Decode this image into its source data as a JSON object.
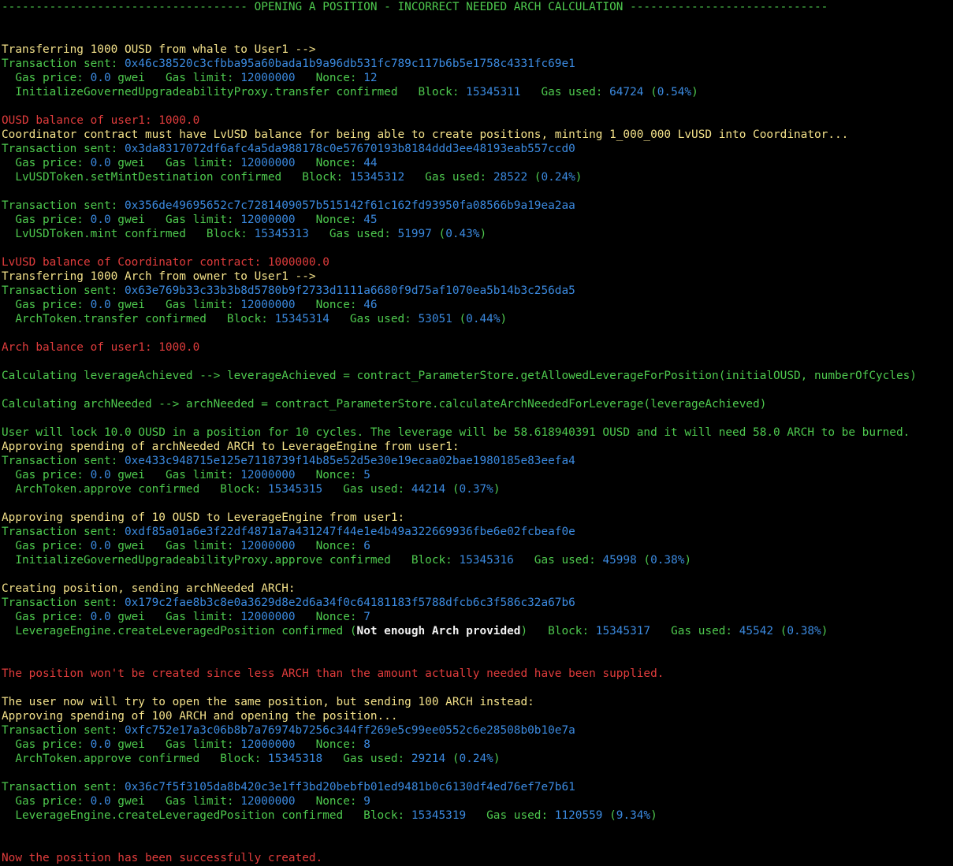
{
  "colors": {
    "background": "#000000",
    "green": "#4ec94e",
    "yellow": "#f3e18a",
    "blue": "#3b8ae0",
    "red": "#e03c3c",
    "bold_white": "#f2f2f2"
  },
  "lines": [
    [
      {
        "t": "------------------------------------ OPENING A POSITION - INCORRECT NEEDED ARCH CALCULATION -----------------------------",
        "c": "green"
      }
    ],
    [],
    [],
    [
      {
        "t": "Transferring 1000 OUSD from whale to User1 -->",
        "c": "yellow"
      }
    ],
    [
      {
        "t": "Transaction sent: ",
        "c": "green"
      },
      {
        "t": "0x46c38520c3cfbba95a60bada1b9a96db531fc789c117b6b5e1758c4331fc69e1",
        "c": "blue"
      }
    ],
    [
      {
        "t": "  Gas price: ",
        "c": "green"
      },
      {
        "t": "0.0",
        "c": "blue"
      },
      {
        "t": " gwei   Gas limit: ",
        "c": "green"
      },
      {
        "t": "12000000",
        "c": "blue"
      },
      {
        "t": "   Nonce: ",
        "c": "green"
      },
      {
        "t": "12",
        "c": "blue"
      }
    ],
    [
      {
        "t": "  InitializeGovernedUpgradeabilityProxy.transfer confirmed   Block: ",
        "c": "green"
      },
      {
        "t": "15345311",
        "c": "blue"
      },
      {
        "t": "   Gas used: ",
        "c": "green"
      },
      {
        "t": "64724",
        "c": "blue"
      },
      {
        "t": " (",
        "c": "green"
      },
      {
        "t": "0.54%",
        "c": "blue"
      },
      {
        "t": ")",
        "c": "green"
      }
    ],
    [],
    [
      {
        "t": "OUSD balance of user1: 1000.0",
        "c": "red"
      }
    ],
    [
      {
        "t": "Coordinator contract must have LvUSD balance for being able to create positions, minting 1_000_000 LvUSD into Coordinator...",
        "c": "yellow"
      }
    ],
    [
      {
        "t": "Transaction sent: ",
        "c": "green"
      },
      {
        "t": "0x3da8317072df6afc4a5da988178c0e57670193b8184ddd3ee48193eab557ccd0",
        "c": "blue"
      }
    ],
    [
      {
        "t": "  Gas price: ",
        "c": "green"
      },
      {
        "t": "0.0",
        "c": "blue"
      },
      {
        "t": " gwei   Gas limit: ",
        "c": "green"
      },
      {
        "t": "12000000",
        "c": "blue"
      },
      {
        "t": "   Nonce: ",
        "c": "green"
      },
      {
        "t": "44",
        "c": "blue"
      }
    ],
    [
      {
        "t": "  LvUSDToken.setMintDestination confirmed   Block: ",
        "c": "green"
      },
      {
        "t": "15345312",
        "c": "blue"
      },
      {
        "t": "   Gas used: ",
        "c": "green"
      },
      {
        "t": "28522",
        "c": "blue"
      },
      {
        "t": " (",
        "c": "green"
      },
      {
        "t": "0.24%",
        "c": "blue"
      },
      {
        "t": ")",
        "c": "green"
      }
    ],
    [],
    [
      {
        "t": "Transaction sent: ",
        "c": "green"
      },
      {
        "t": "0x356de49695652c7c7281409057b515142f61c162fd93950fa08566b9a19ea2aa",
        "c": "blue"
      }
    ],
    [
      {
        "t": "  Gas price: ",
        "c": "green"
      },
      {
        "t": "0.0",
        "c": "blue"
      },
      {
        "t": " gwei   Gas limit: ",
        "c": "green"
      },
      {
        "t": "12000000",
        "c": "blue"
      },
      {
        "t": "   Nonce: ",
        "c": "green"
      },
      {
        "t": "45",
        "c": "blue"
      }
    ],
    [
      {
        "t": "  LvUSDToken.mint confirmed   Block: ",
        "c": "green"
      },
      {
        "t": "15345313",
        "c": "blue"
      },
      {
        "t": "   Gas used: ",
        "c": "green"
      },
      {
        "t": "51997",
        "c": "blue"
      },
      {
        "t": " (",
        "c": "green"
      },
      {
        "t": "0.43%",
        "c": "blue"
      },
      {
        "t": ")",
        "c": "green"
      }
    ],
    [],
    [
      {
        "t": "LvUSD balance of Coordinator contract: 1000000.0",
        "c": "red"
      }
    ],
    [
      {
        "t": "Transferring 1000 Arch from owner to User1 -->",
        "c": "yellow"
      }
    ],
    [
      {
        "t": "Transaction sent: ",
        "c": "green"
      },
      {
        "t": "0x63e769b33c33b3b8d5780b9f2733d1111a6680f9d75af1070ea5b14b3c256da5",
        "c": "blue"
      }
    ],
    [
      {
        "t": "  Gas price: ",
        "c": "green"
      },
      {
        "t": "0.0",
        "c": "blue"
      },
      {
        "t": " gwei   Gas limit: ",
        "c": "green"
      },
      {
        "t": "12000000",
        "c": "blue"
      },
      {
        "t": "   Nonce: ",
        "c": "green"
      },
      {
        "t": "46",
        "c": "blue"
      }
    ],
    [
      {
        "t": "  ArchToken.transfer confirmed   Block: ",
        "c": "green"
      },
      {
        "t": "15345314",
        "c": "blue"
      },
      {
        "t": "   Gas used: ",
        "c": "green"
      },
      {
        "t": "53051",
        "c": "blue"
      },
      {
        "t": " (",
        "c": "green"
      },
      {
        "t": "0.44%",
        "c": "blue"
      },
      {
        "t": ")",
        "c": "green"
      }
    ],
    [],
    [
      {
        "t": "Arch balance of user1: 1000.0",
        "c": "red"
      }
    ],
    [],
    [
      {
        "t": "Calculating leverageAchieved --> leverageAchieved = contract_ParameterStore.getAllowedLeverageForPosition(initialOUSD, numberOfCycles)",
        "c": "green"
      }
    ],
    [],
    [
      {
        "t": "Calculating archNeeded --> archNeeded = contract_ParameterStore.calculateArchNeededForLeverage(leverageAchieved)",
        "c": "green"
      }
    ],
    [],
    [
      {
        "t": "User will lock 10.0 OUSD in a position for 10 cycles. The leverage will be 58.618940391 OUSD and it will need 58.0 ARCH to be burned.",
        "c": "green"
      }
    ],
    [
      {
        "t": "Approving spending of archNeeded ARCH to LeverageEngine from user1:",
        "c": "yellow"
      }
    ],
    [
      {
        "t": "Transaction sent: ",
        "c": "green"
      },
      {
        "t": "0xe433c948715e125e7118739f14b85e52d5e30e19ecaa02bae1980185e83eefa4",
        "c": "blue"
      }
    ],
    [
      {
        "t": "  Gas price: ",
        "c": "green"
      },
      {
        "t": "0.0",
        "c": "blue"
      },
      {
        "t": " gwei   Gas limit: ",
        "c": "green"
      },
      {
        "t": "12000000",
        "c": "blue"
      },
      {
        "t": "   Nonce: ",
        "c": "green"
      },
      {
        "t": "5",
        "c": "blue"
      }
    ],
    [
      {
        "t": "  ArchToken.approve confirmed   Block: ",
        "c": "green"
      },
      {
        "t": "15345315",
        "c": "blue"
      },
      {
        "t": "   Gas used: ",
        "c": "green"
      },
      {
        "t": "44214",
        "c": "blue"
      },
      {
        "t": " (",
        "c": "green"
      },
      {
        "t": "0.37%",
        "c": "blue"
      },
      {
        "t": ")",
        "c": "green"
      }
    ],
    [],
    [
      {
        "t": "Approving spending of 10 OUSD to LeverageEngine from user1:",
        "c": "yellow"
      }
    ],
    [
      {
        "t": "Transaction sent: ",
        "c": "green"
      },
      {
        "t": "0xdf85a01a6e3f22df4871a7a431247f44e1e4b49a322669936fbe6e02fcbeaf0e",
        "c": "blue"
      }
    ],
    [
      {
        "t": "  Gas price: ",
        "c": "green"
      },
      {
        "t": "0.0",
        "c": "blue"
      },
      {
        "t": " gwei   Gas limit: ",
        "c": "green"
      },
      {
        "t": "12000000",
        "c": "blue"
      },
      {
        "t": "   Nonce: ",
        "c": "green"
      },
      {
        "t": "6",
        "c": "blue"
      }
    ],
    [
      {
        "t": "  InitializeGovernedUpgradeabilityProxy.approve confirmed   Block: ",
        "c": "green"
      },
      {
        "t": "15345316",
        "c": "blue"
      },
      {
        "t": "   Gas used: ",
        "c": "green"
      },
      {
        "t": "45998",
        "c": "blue"
      },
      {
        "t": " (",
        "c": "green"
      },
      {
        "t": "0.38%",
        "c": "blue"
      },
      {
        "t": ")",
        "c": "green"
      }
    ],
    [],
    [
      {
        "t": "Creating position, sending archNeeded ARCH:",
        "c": "yellow"
      }
    ],
    [
      {
        "t": "Transaction sent: ",
        "c": "green"
      },
      {
        "t": "0x179c2fae8b3c8e0a3629d8e2d6a34f0c64181183f5788dfcb6c3f586c32a67b6",
        "c": "blue"
      }
    ],
    [
      {
        "t": "  Gas price: ",
        "c": "green"
      },
      {
        "t": "0.0",
        "c": "blue"
      },
      {
        "t": " gwei   Gas limit: ",
        "c": "green"
      },
      {
        "t": "12000000",
        "c": "blue"
      },
      {
        "t": "   Nonce: ",
        "c": "green"
      },
      {
        "t": "7",
        "c": "blue"
      }
    ],
    [
      {
        "t": "  LeverageEngine.createLeveragedPosition confirmed (",
        "c": "green"
      },
      {
        "t": "Not enough Arch provided",
        "c": "bold"
      },
      {
        "t": ")   Block: ",
        "c": "green"
      },
      {
        "t": "15345317",
        "c": "blue"
      },
      {
        "t": "   Gas used: ",
        "c": "green"
      },
      {
        "t": "45542",
        "c": "blue"
      },
      {
        "t": " (",
        "c": "green"
      },
      {
        "t": "0.38%",
        "c": "blue"
      },
      {
        "t": ")",
        "c": "green"
      }
    ],
    [],
    [],
    [
      {
        "t": "The position won't be created since less ARCH than the amount actually needed have been supplied.",
        "c": "red"
      }
    ],
    [],
    [
      {
        "t": "The user now will try to open the same position, but sending 100 ARCH instead:",
        "c": "yellow"
      }
    ],
    [
      {
        "t": "Approving spending of 100 ARCH and opening the position...",
        "c": "yellow"
      }
    ],
    [
      {
        "t": "Transaction sent: ",
        "c": "green"
      },
      {
        "t": "0xfc752e17a3c06b8b7a76974b7256c344ff269e5c99ee0552c6e28508b0b10e7a",
        "c": "blue"
      }
    ],
    [
      {
        "t": "  Gas price: ",
        "c": "green"
      },
      {
        "t": "0.0",
        "c": "blue"
      },
      {
        "t": " gwei   Gas limit: ",
        "c": "green"
      },
      {
        "t": "12000000",
        "c": "blue"
      },
      {
        "t": "   Nonce: ",
        "c": "green"
      },
      {
        "t": "8",
        "c": "blue"
      }
    ],
    [
      {
        "t": "  ArchToken.approve confirmed   Block: ",
        "c": "green"
      },
      {
        "t": "15345318",
        "c": "blue"
      },
      {
        "t": "   Gas used: ",
        "c": "green"
      },
      {
        "t": "29214",
        "c": "blue"
      },
      {
        "t": " (",
        "c": "green"
      },
      {
        "t": "0.24%",
        "c": "blue"
      },
      {
        "t": ")",
        "c": "green"
      }
    ],
    [],
    [
      {
        "t": "Transaction sent: ",
        "c": "green"
      },
      {
        "t": "0x36c7f5f3105da8b420c3e1ff3bd20bebfb01ed9481b0c6130df4ed76ef7e7b61",
        "c": "blue"
      }
    ],
    [
      {
        "t": "  Gas price: ",
        "c": "green"
      },
      {
        "t": "0.0",
        "c": "blue"
      },
      {
        "t": " gwei   Gas limit: ",
        "c": "green"
      },
      {
        "t": "12000000",
        "c": "blue"
      },
      {
        "t": "   Nonce: ",
        "c": "green"
      },
      {
        "t": "9",
        "c": "blue"
      }
    ],
    [
      {
        "t": "  LeverageEngine.createLeveragedPosition confirmed   Block: ",
        "c": "green"
      },
      {
        "t": "15345319",
        "c": "blue"
      },
      {
        "t": "   Gas used: ",
        "c": "green"
      },
      {
        "t": "1120559",
        "c": "blue"
      },
      {
        "t": " (",
        "c": "green"
      },
      {
        "t": "9.34%",
        "c": "blue"
      },
      {
        "t": ")",
        "c": "green"
      }
    ],
    [],
    [],
    [
      {
        "t": "Now the position has been successfully created.",
        "c": "red"
      }
    ]
  ]
}
